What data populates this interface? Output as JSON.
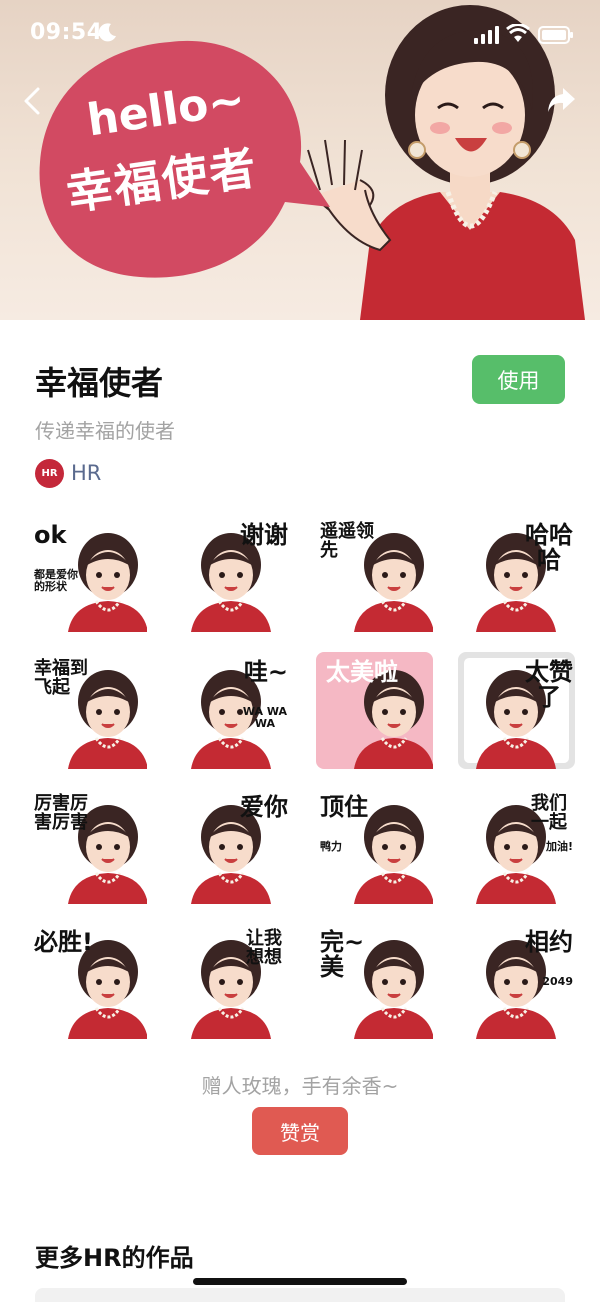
{
  "status": {
    "time": "09:54"
  },
  "banner": {
    "hello": "hello~",
    "title": "幸福使者",
    "bubble_color": "#d24a62"
  },
  "pack": {
    "title": "幸福使者",
    "subtitle": "传递幸福的使者",
    "use_label": "使用",
    "use_color": "#57be6a",
    "author_badge": "HR",
    "author_name": "HR"
  },
  "stickers": [
    {
      "text": "ok",
      "sub": "都是爱你的形状"
    },
    {
      "text": "谢谢"
    },
    {
      "text": "遥遥领先"
    },
    {
      "text": "哈哈哈"
    },
    {
      "text": "幸福到飞起"
    },
    {
      "text": "哇~",
      "sub": "WA WA WA"
    },
    {
      "text": "太美啦"
    },
    {
      "text": "太赞了"
    },
    {
      "text": "厉害厉害厉害"
    },
    {
      "text": "爱你"
    },
    {
      "text": "顶住",
      "sub": "鸭力"
    },
    {
      "text": "我们一起",
      "sub": "加油!"
    },
    {
      "text": "必胜!"
    },
    {
      "text": "让我想想"
    },
    {
      "text": "完~美"
    },
    {
      "text": "相约",
      "sub": "2049"
    }
  ],
  "footer": {
    "reward_text": "赠人玫瑰，手有余香~",
    "reward_label": "赞赏",
    "reward_color": "#e05a52",
    "more_title": "更多HR的作品"
  }
}
